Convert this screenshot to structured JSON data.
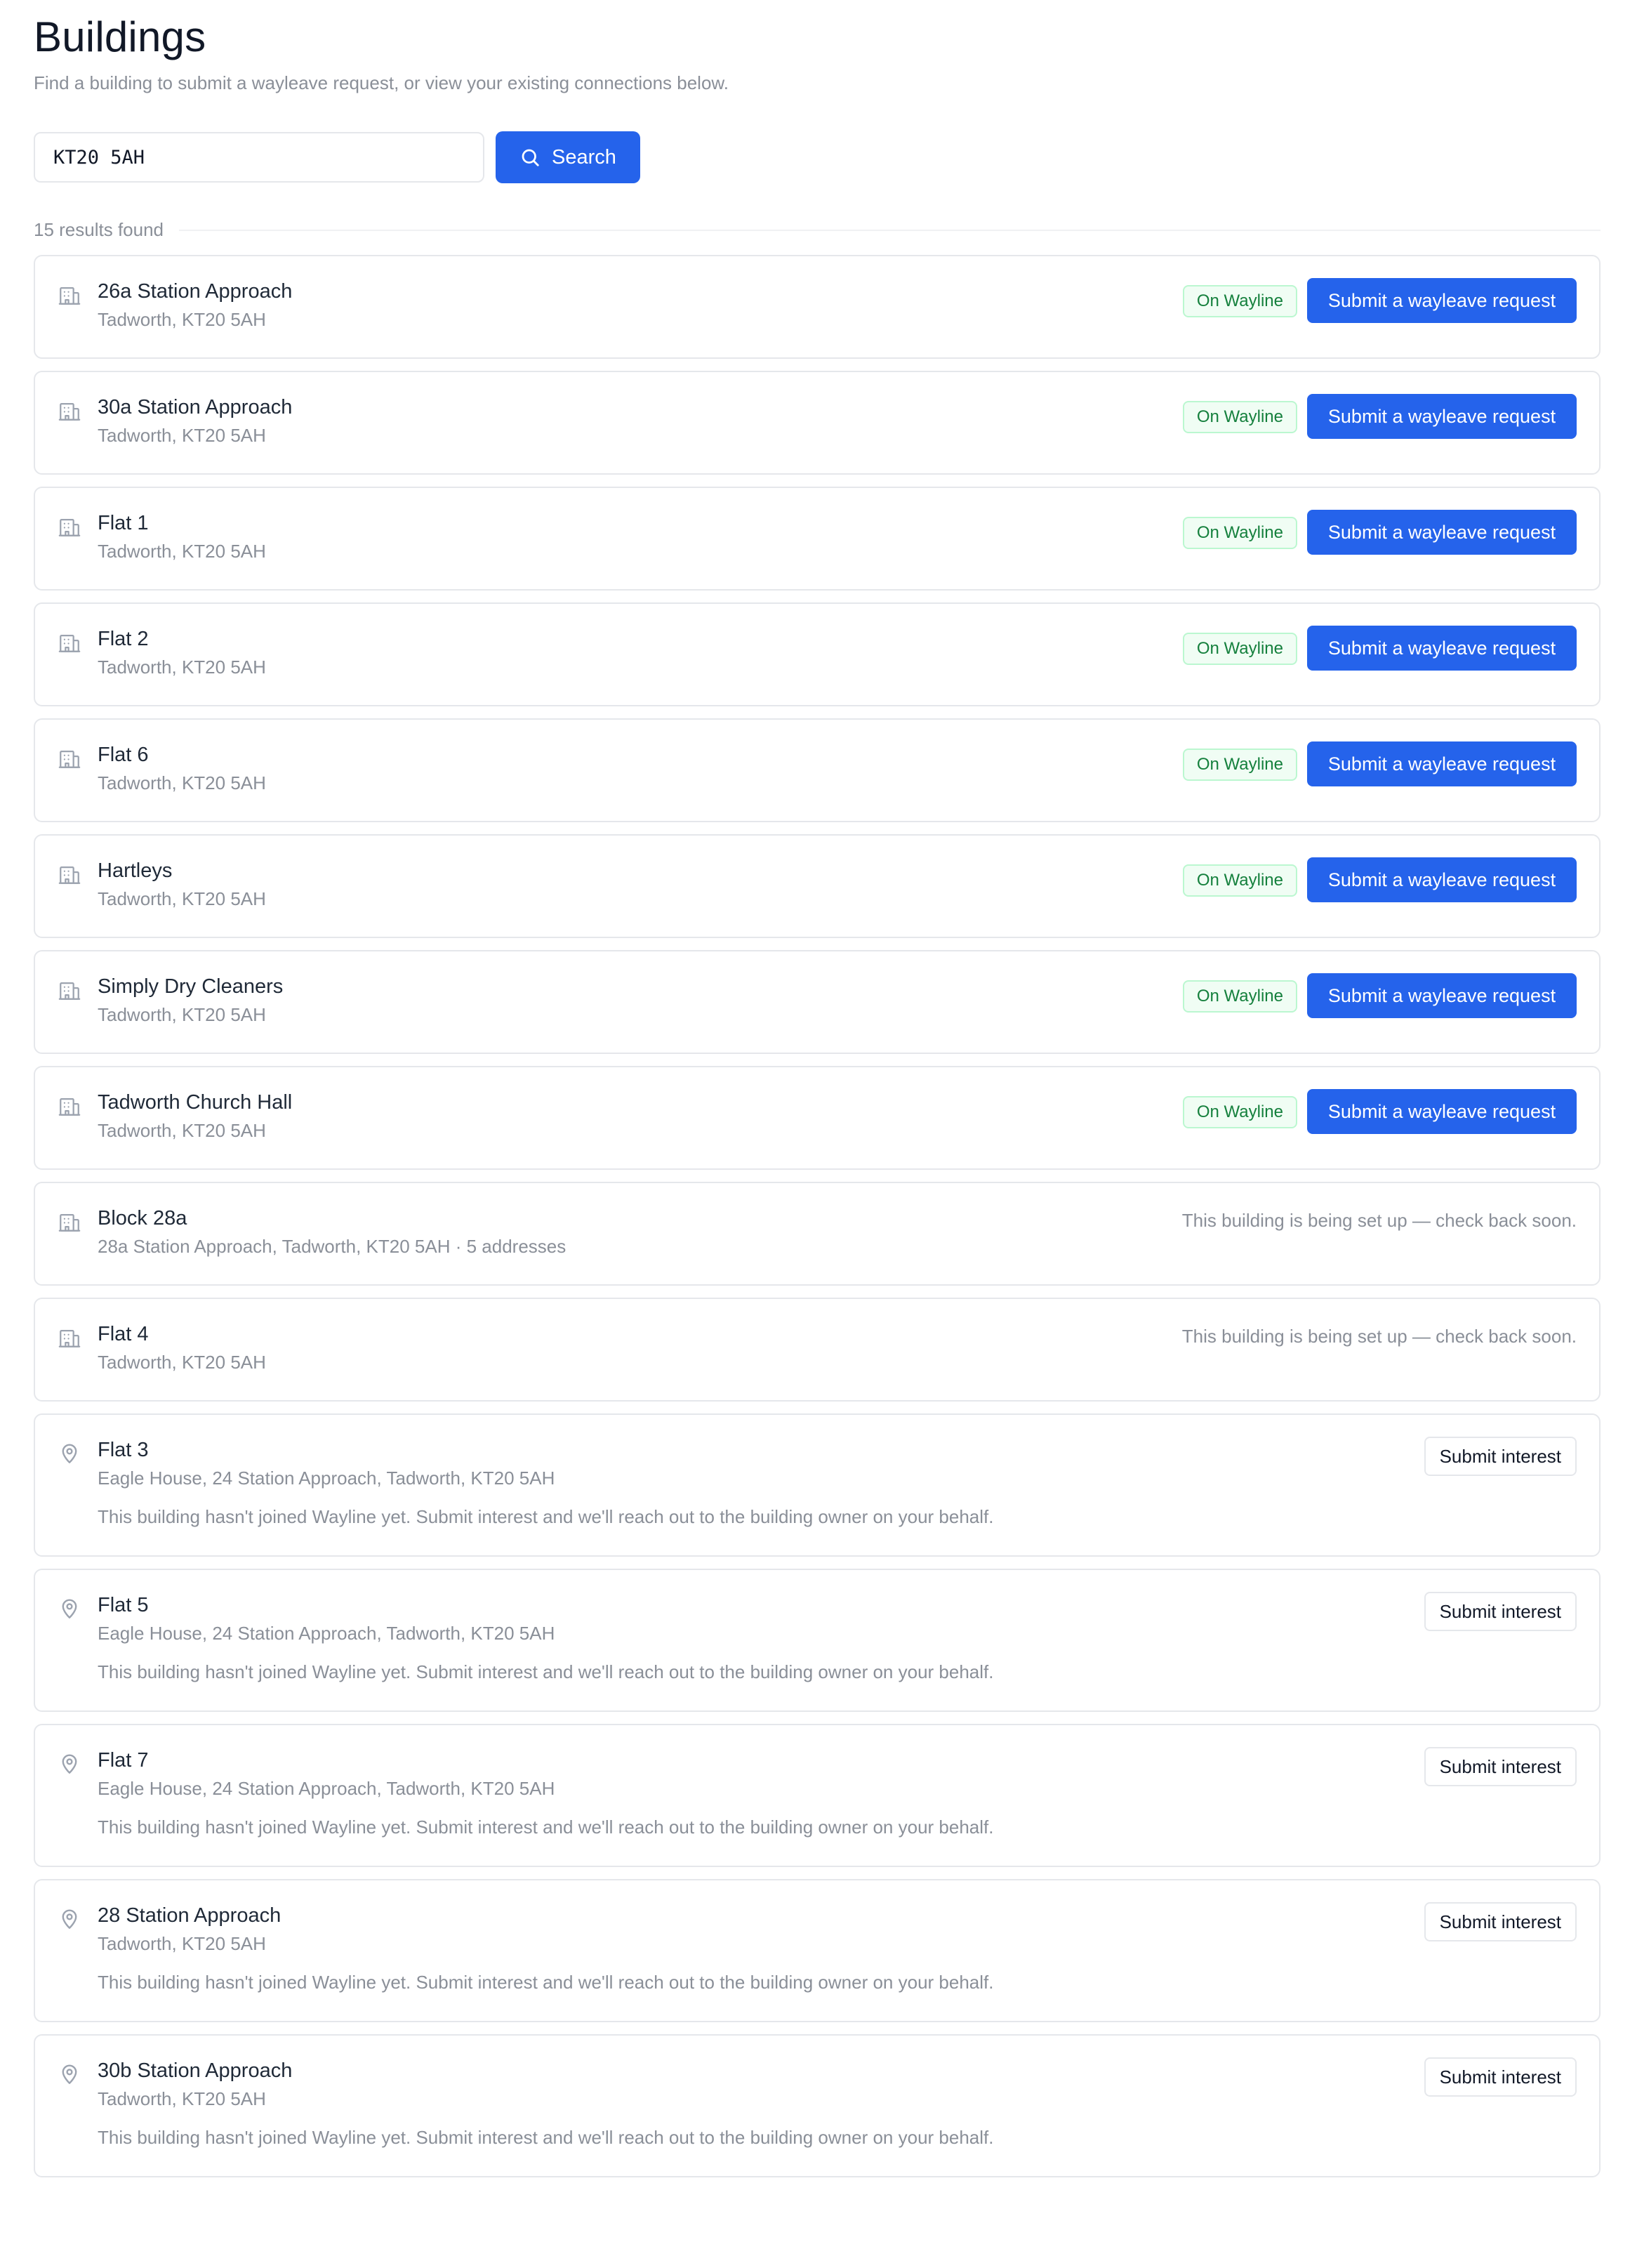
{
  "page": {
    "title": "Buildings",
    "subtitle": "Find a building to submit a wayleave request, or view your existing connections below."
  },
  "search": {
    "value": "KT20 5AH",
    "button_label": "Search",
    "button_icon": "search-icon"
  },
  "results": {
    "count_label": "15 results found",
    "on_wayline": [
      {
        "name": "26a Station Approach",
        "address": "Tadworth, KT20 5AH",
        "badge": "On Wayline",
        "action": "Submit a wayleave request",
        "icon": "building-icon"
      },
      {
        "name": "30a Station Approach",
        "address": "Tadworth, KT20 5AH",
        "badge": "On Wayline",
        "action": "Submit a wayleave request",
        "icon": "building-icon"
      },
      {
        "name": "Flat 1",
        "address": "Tadworth, KT20 5AH",
        "badge": "On Wayline",
        "action": "Submit a wayleave request",
        "icon": "building-icon"
      },
      {
        "name": "Flat 2",
        "address": "Tadworth, KT20 5AH",
        "badge": "On Wayline",
        "action": "Submit a wayleave request",
        "icon": "building-icon"
      },
      {
        "name": "Flat 6",
        "address": "Tadworth, KT20 5AH",
        "badge": "On Wayline",
        "action": "Submit a wayleave request",
        "icon": "building-icon"
      },
      {
        "name": "Hartleys",
        "address": "Tadworth, KT20 5AH",
        "badge": "On Wayline",
        "action": "Submit a wayleave request",
        "icon": "building-icon"
      },
      {
        "name": "Simply Dry Cleaners",
        "address": "Tadworth, KT20 5AH",
        "badge": "On Wayline",
        "action": "Submit a wayleave request",
        "icon": "building-icon"
      },
      {
        "name": "Tadworth Church Hall",
        "address": "Tadworth, KT20 5AH",
        "badge": "On Wayline",
        "action": "Submit a wayleave request",
        "icon": "building-icon"
      }
    ],
    "setting_up": [
      {
        "name": "Block 28a",
        "address": "28a Station Approach, Tadworth, KT20 5AH · 5 addresses",
        "note": "This building is being set up — check back soon.",
        "icon": "building-icon"
      },
      {
        "name": "Flat 4",
        "address": "Tadworth, KT20 5AH",
        "note": "This building is being set up — check back soon.",
        "icon": "building-icon"
      }
    ],
    "not_joined": [
      {
        "name": "Flat 3",
        "address": "Eagle House, 24 Station Approach, Tadworth, KT20 5AH",
        "note": "This building hasn't joined Wayline yet. Submit interest and we'll reach out to the building owner on your behalf.",
        "action": "Submit interest",
        "icon": "map-pin-icon"
      },
      {
        "name": "Flat 5",
        "address": "Eagle House, 24 Station Approach, Tadworth, KT20 5AH",
        "note": "This building hasn't joined Wayline yet. Submit interest and we'll reach out to the building owner on your behalf.",
        "action": "Submit interest",
        "icon": "map-pin-icon"
      },
      {
        "name": "Flat 7",
        "address": "Eagle House, 24 Station Approach, Tadworth, KT20 5AH",
        "note": "This building hasn't joined Wayline yet. Submit interest and we'll reach out to the building owner on your behalf.",
        "action": "Submit interest",
        "icon": "map-pin-icon"
      },
      {
        "name": "28 Station Approach",
        "address": "Tadworth, KT20 5AH",
        "note": "This building hasn't joined Wayline yet. Submit interest and we'll reach out to the building owner on your behalf.",
        "action": "Submit interest",
        "icon": "map-pin-icon"
      },
      {
        "name": "30b Station Approach",
        "address": "Tadworth, KT20 5AH",
        "note": "This building hasn't joined Wayline yet. Submit interest and we'll reach out to the building owner on your behalf.",
        "action": "Submit interest",
        "icon": "map-pin-icon"
      }
    ]
  },
  "colors": {
    "primary": "#2563eb",
    "badge_text": "#15803d",
    "badge_bg": "#f0fdf4",
    "muted_text": "#8a8f98"
  }
}
